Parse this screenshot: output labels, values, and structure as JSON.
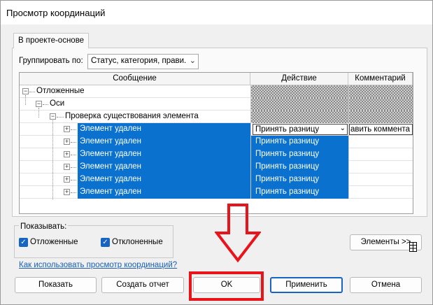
{
  "window": {
    "title": "Просмотр координаций"
  },
  "tabs": [
    {
      "label": "В проекте-основе"
    }
  ],
  "group_by": {
    "label": "Группировать по:",
    "value": "Статус, категория, прави."
  },
  "grid": {
    "columns": {
      "message": "Сообщение",
      "action": "Действие",
      "comment": "Комментарий"
    },
    "tree": {
      "level1": "Отложенные",
      "level2": "Оси",
      "level3": "Проверка существования элемента"
    },
    "rows": [
      {
        "message": "Элемент удален",
        "action": "Принять разницу",
        "comment": "авить коммента",
        "editing": true
      },
      {
        "message": "Элемент удален",
        "action": "Принять разницу",
        "comment": ""
      },
      {
        "message": "Элемент удален",
        "action": "Принять разницу",
        "comment": ""
      },
      {
        "message": "Элемент удален",
        "action": "Принять разницу",
        "comment": ""
      },
      {
        "message": "Элемент удален",
        "action": "Принять разницу",
        "comment": ""
      },
      {
        "message": "Элемент удален",
        "action": "Принять разницу",
        "comment": ""
      }
    ]
  },
  "show": {
    "label": "Показывать:",
    "postponed": {
      "label": "Отложенные",
      "checked": true
    },
    "rejected": {
      "label": "Отклоненные",
      "checked": true
    }
  },
  "elements_button": "Элементы >>",
  "help_link": "Как использовать просмотр координаций?",
  "buttons": {
    "show": "Показать",
    "report": "Создать отчет",
    "ok": "OK",
    "apply": "Применить",
    "cancel": "Отмена"
  },
  "colors": {
    "selection": "#0a71cf",
    "annotation": "#e8141a",
    "accent": "#1664c4"
  },
  "icons": {
    "expand": "plus-box",
    "collapse": "minus-box",
    "dropdown": "chevron-down"
  }
}
